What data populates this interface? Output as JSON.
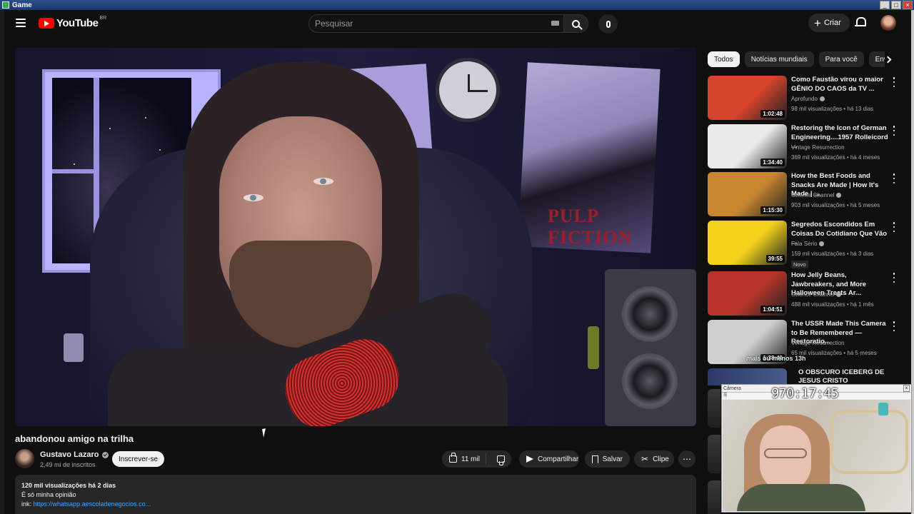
{
  "os_window": {
    "title": "Game"
  },
  "header": {
    "logo_text": "YouTube",
    "logo_country": "BR",
    "search": {
      "placeholder": "Pesquisar",
      "value": ""
    },
    "create_label": "Criar"
  },
  "video": {
    "title": "abandonou amigo na trilha",
    "channel": {
      "name": "Gustavo Lazaro",
      "subscribers": "2,49 mi de inscritos"
    },
    "subscribe_label": "Inscrever-se",
    "actions": {
      "like_count": "11 mil",
      "share_label": "Compartilhar",
      "save_label": "Salvar",
      "clip_label": "Clipe"
    },
    "poster_text": "PULP FICTION",
    "description": {
      "stats": "120 mil visualizações  há 2 dias",
      "line1": "É só minha opinião",
      "link_prefix": "ink:",
      "link": "https://whatsapp.aescoladenegocios.co..."
    }
  },
  "sidebar": {
    "chips": [
      "Todos",
      "Notícias mundiais",
      "Para você",
      "Envi"
    ],
    "active_chip": "Todos",
    "related": [
      {
        "title": "Como Faustão virou o maior GÊNIO DO CAOS da TV ...",
        "channel": "Aprofundo",
        "verified": true,
        "meta": "98 mil visualizações • há 13 dias",
        "duration": "1:02:48",
        "thumb_color": "#d4432c"
      },
      {
        "title": "Restoring the Icon of German Engineering....1957 Rolleicord ...",
        "channel": "Vintage Resurrection",
        "verified": false,
        "meta": "369 mil visualizações • há 4 meses",
        "duration": "1:34:40",
        "thumb_color": "#e9e9e9"
      },
      {
        "title": "How the Best Foods and Snacks Are Made | How It's Made | ...",
        "channel": "Science Channel",
        "verified": true,
        "meta": "903 mil visualizações • há 5 meses",
        "duration": "1:15:30",
        "thumb_color": "#c9862f"
      },
      {
        "title": "Segredos Escondidos Em Coisas Do Cotidiano Que Vão ...",
        "channel": "Fala Sério",
        "verified": true,
        "meta": "159 mil visualizações • há 3 dias",
        "duration": "39:55",
        "badge": "Novo",
        "thumb_color": "#f2d21b"
      },
      {
        "title": "How Jelly Beans, Jawbreakers, and More Halloween Treats Ar...",
        "channel": "Science Channel",
        "verified": true,
        "meta": "488 mil visualizações • há 1 mês",
        "duration": "1:04:51",
        "thumb_color": "#b8342a"
      },
      {
        "title": "The USSR Made This Camera to Be Remembered — Restoratio...",
        "channel": "Vintage Resurrection",
        "verified": false,
        "meta": "65 mil visualizações • há 5 meses",
        "duration": "1:38:40",
        "thumb_color": "#cfcfcf"
      }
    ],
    "partial_item_title": "O OBSCURO ICEBERG DE JESUS CRISTO"
  },
  "overlay": {
    "chat_line": "mais ou menos 13h",
    "webcam_title": "Câmera",
    "timer": "970:17:45"
  },
  "colors": {
    "accent_red": "#ff0000",
    "link_blue": "#3ea6ff",
    "background": "#0f0f0f"
  }
}
